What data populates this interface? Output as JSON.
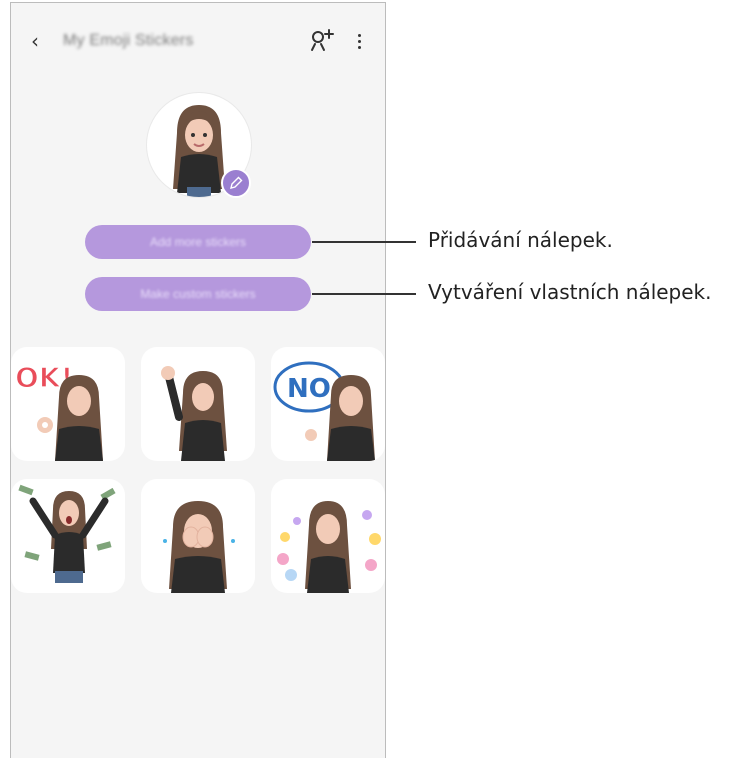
{
  "app": {
    "title": "My Emoji Stickers"
  },
  "buttons": {
    "add_more": "Add more stickers",
    "make_custom": "Make custom stickers"
  },
  "icons": {
    "back": "back-chevron-icon",
    "add_person": "add-person-icon",
    "more": "more-options-icon",
    "edit": "edit-pencil-icon"
  },
  "stickers": [
    {
      "label": "OK!"
    },
    {
      "label": ""
    },
    {
      "label": "NO"
    },
    {
      "label": ""
    },
    {
      "label": ""
    },
    {
      "label": ""
    }
  ],
  "callouts": [
    "Přidávání nálepek.",
    "Vytváření vlastních nálepek."
  ],
  "colors": {
    "accent": "#b598dd",
    "badge": "#9a7fd0",
    "background": "#f5f5f5"
  }
}
